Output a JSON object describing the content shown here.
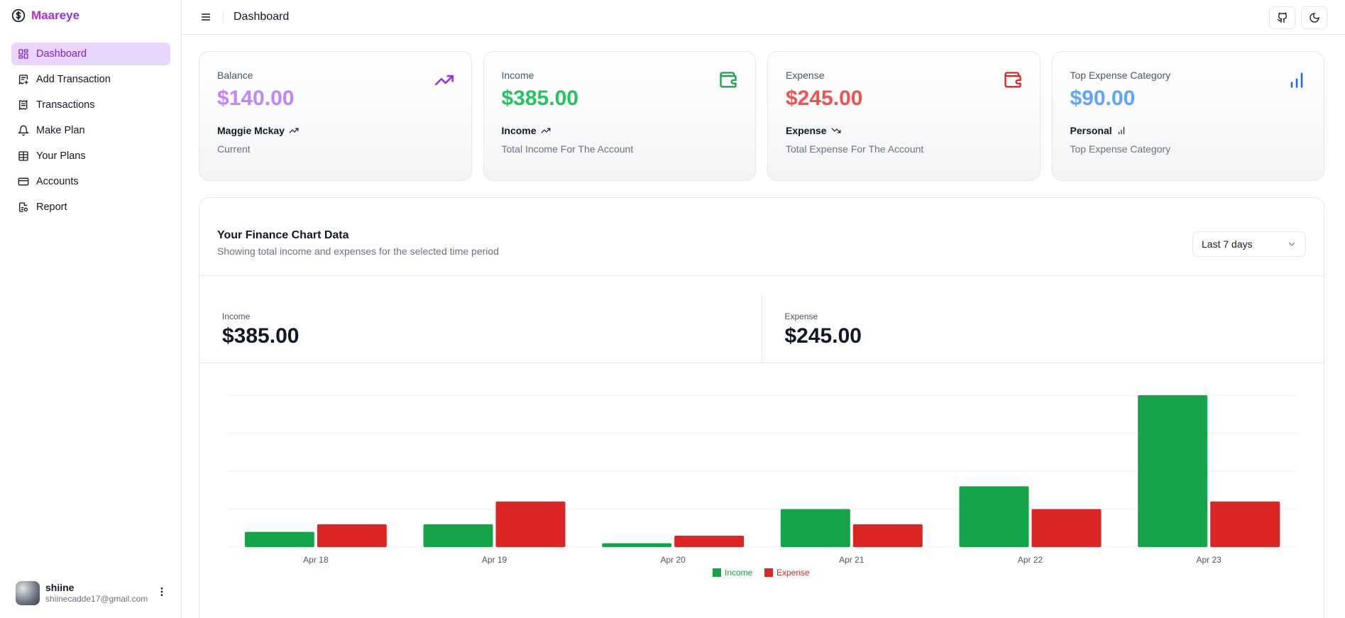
{
  "app": {
    "name": "Maareye"
  },
  "sidebar": {
    "items": [
      {
        "label": "Dashboard",
        "icon": "grid-icon",
        "active": true
      },
      {
        "label": "Add Transaction",
        "icon": "receipt-add-icon"
      },
      {
        "label": "Transactions",
        "icon": "receipt-icon"
      },
      {
        "label": "Make Plan",
        "icon": "bell-plus-icon"
      },
      {
        "label": "Your Plans",
        "icon": "table-icon"
      },
      {
        "label": "Accounts",
        "icon": "card-icon"
      },
      {
        "label": "Report",
        "icon": "report-icon"
      }
    ]
  },
  "user": {
    "name": "shiine",
    "email": "shiinecadde17@gmail.com"
  },
  "header": {
    "title": "Dashboard"
  },
  "cards": [
    {
      "label": "Balance",
      "value": "$140.00",
      "sub": "Maggie Mckay",
      "desc": "Current",
      "color": "#c084fc",
      "icon": "trending-up-icon",
      "sub_icon": "trending-up-icon"
    },
    {
      "label": "Income",
      "value": "$385.00",
      "sub": "Income",
      "desc": "Total Income For The Account",
      "color": "#22c55e",
      "icon": "wallet-icon",
      "sub_icon": "trending-up-icon"
    },
    {
      "label": "Expense",
      "value": "$245.00",
      "sub": "Expense",
      "desc": "Total Expense For The Account",
      "color": "#f05252",
      "icon": "wallet-icon",
      "sub_icon": "trending-down-icon"
    },
    {
      "label": "Top Expense Category",
      "value": "$90.00",
      "sub": "Personal",
      "desc": "Top Expense Category",
      "color": "#60a5fa",
      "icon": "bar-chart-icon",
      "sub_icon": "bar-chart-icon"
    }
  ],
  "panel": {
    "title": "Your Finance Chart Data",
    "description": "Showing total income and expenses for the selected time period",
    "range": "Last 7 days",
    "totals": [
      {
        "label": "Income",
        "value": "$385.00"
      },
      {
        "label": "Expense",
        "value": "$245.00"
      }
    ]
  },
  "chart_data": {
    "type": "bar",
    "categories": [
      "Apr 18",
      "Apr 19",
      "Apr 20",
      "Apr 21",
      "Apr 22",
      "Apr 23"
    ],
    "series": [
      {
        "name": "Income",
        "color": "#16a34a",
        "values": [
          20,
          30,
          5,
          50,
          80,
          200
        ]
      },
      {
        "name": "Expense",
        "color": "#dc2626",
        "values": [
          30,
          60,
          15,
          30,
          50,
          60
        ]
      }
    ],
    "ylim": [
      0,
      200
    ],
    "grid": true,
    "legend": "bottom-center"
  }
}
